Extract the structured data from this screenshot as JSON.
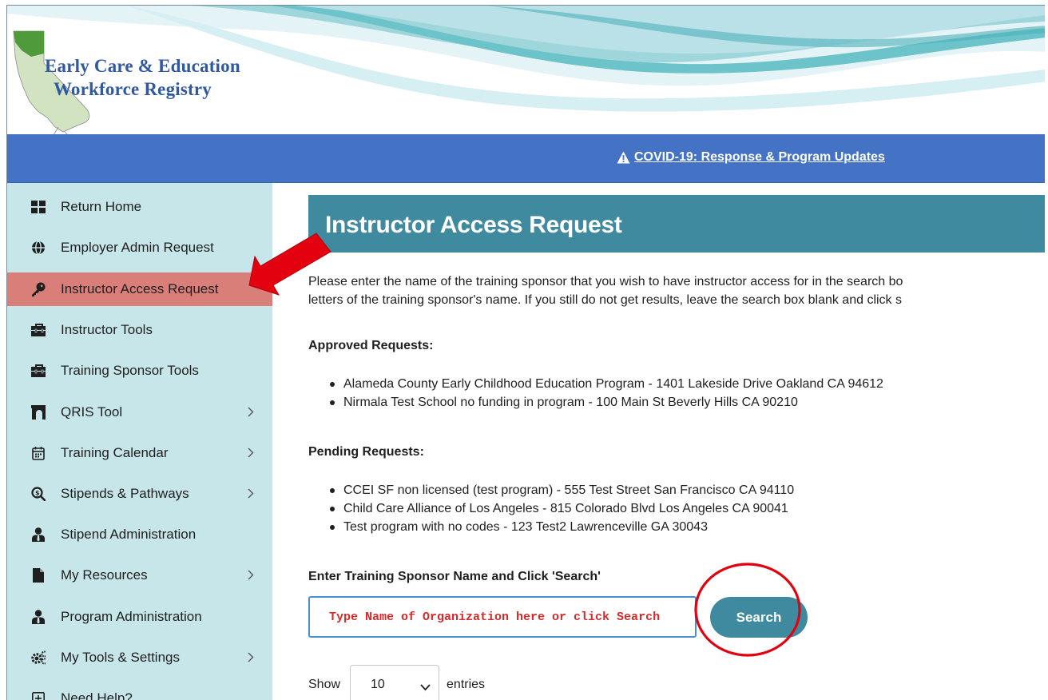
{
  "header": {
    "logo_line1": "Early Care & Education",
    "logo_line2": "Workforce Registry"
  },
  "covid_bar": {
    "link_text": "COVID-19: Response & Program Updates",
    "icon": "warning-icon"
  },
  "sidebar": {
    "items": [
      {
        "label": "Return Home",
        "icon": "grid-icon",
        "has_submenu": false
      },
      {
        "label": "Employer Admin Request",
        "icon": "globe-icon",
        "has_submenu": false
      },
      {
        "label": "Instructor Access Request",
        "icon": "key-icon",
        "has_submenu": false,
        "active": true
      },
      {
        "label": "Instructor Tools",
        "icon": "toolbox-icon",
        "has_submenu": false
      },
      {
        "label": "Training Sponsor Tools",
        "icon": "toolbox-icon",
        "has_submenu": false
      },
      {
        "label": "QRIS Tool",
        "icon": "archway-icon",
        "has_submenu": true
      },
      {
        "label": "Training Calendar",
        "icon": "calendar-icon",
        "has_submenu": true
      },
      {
        "label": "Stipends & Pathways",
        "icon": "search-dollar-icon",
        "has_submenu": true
      },
      {
        "label": "Stipend Administration",
        "icon": "user-tie-icon",
        "has_submenu": false
      },
      {
        "label": "My Resources",
        "icon": "file-icon",
        "has_submenu": true
      },
      {
        "label": "Program Administration",
        "icon": "user-tie-icon",
        "has_submenu": false
      },
      {
        "label": "My Tools & Settings",
        "icon": "cogs-icon",
        "has_submenu": true
      },
      {
        "label": "Need Help?",
        "icon": "plus-square-icon",
        "has_submenu": false
      }
    ]
  },
  "main": {
    "title": "Instructor Access Request",
    "intro_line1": "Please enter the name of the training sponsor that you wish to have instructor access for in the search bo",
    "intro_line2": "letters of the training sponsor's name. If you still do not get results, leave the search box blank and click s",
    "approved_title": "Approved Requests:",
    "approved": [
      "Alameda County Early Childhood Education Program - 1401 Lakeside Drive Oakland CA 94612",
      "Nirmala Test School no funding in program - 100 Main St Beverly Hills CA 90210"
    ],
    "pending_title": "Pending Requests:",
    "pending": [
      "CCEI SF non licensed (test program) - 555 Test Street San Francisco CA 94110",
      "Child Care Alliance of Los Angeles - 815 Colorado Blvd Los Angeles CA 90041",
      "Test program with no codes - 123 Test2 Lawrenceville GA 30043"
    ],
    "search_label": "Enter Training Sponsor Name and Click 'Search'",
    "search_placeholder": "Type Name of Organization here or click Search",
    "search_button": "Search",
    "show_label": "Show",
    "show_value": "10",
    "entries_label": "entries"
  },
  "colors": {
    "sidebar_bg": "#c7e6ea",
    "active_item_bg": "#d97e78",
    "covid_bar_bg": "#4472c4",
    "banner_bg": "#3f8a9f",
    "annotation_red": "#e3000f",
    "logo_blue": "#2f5aa2"
  }
}
